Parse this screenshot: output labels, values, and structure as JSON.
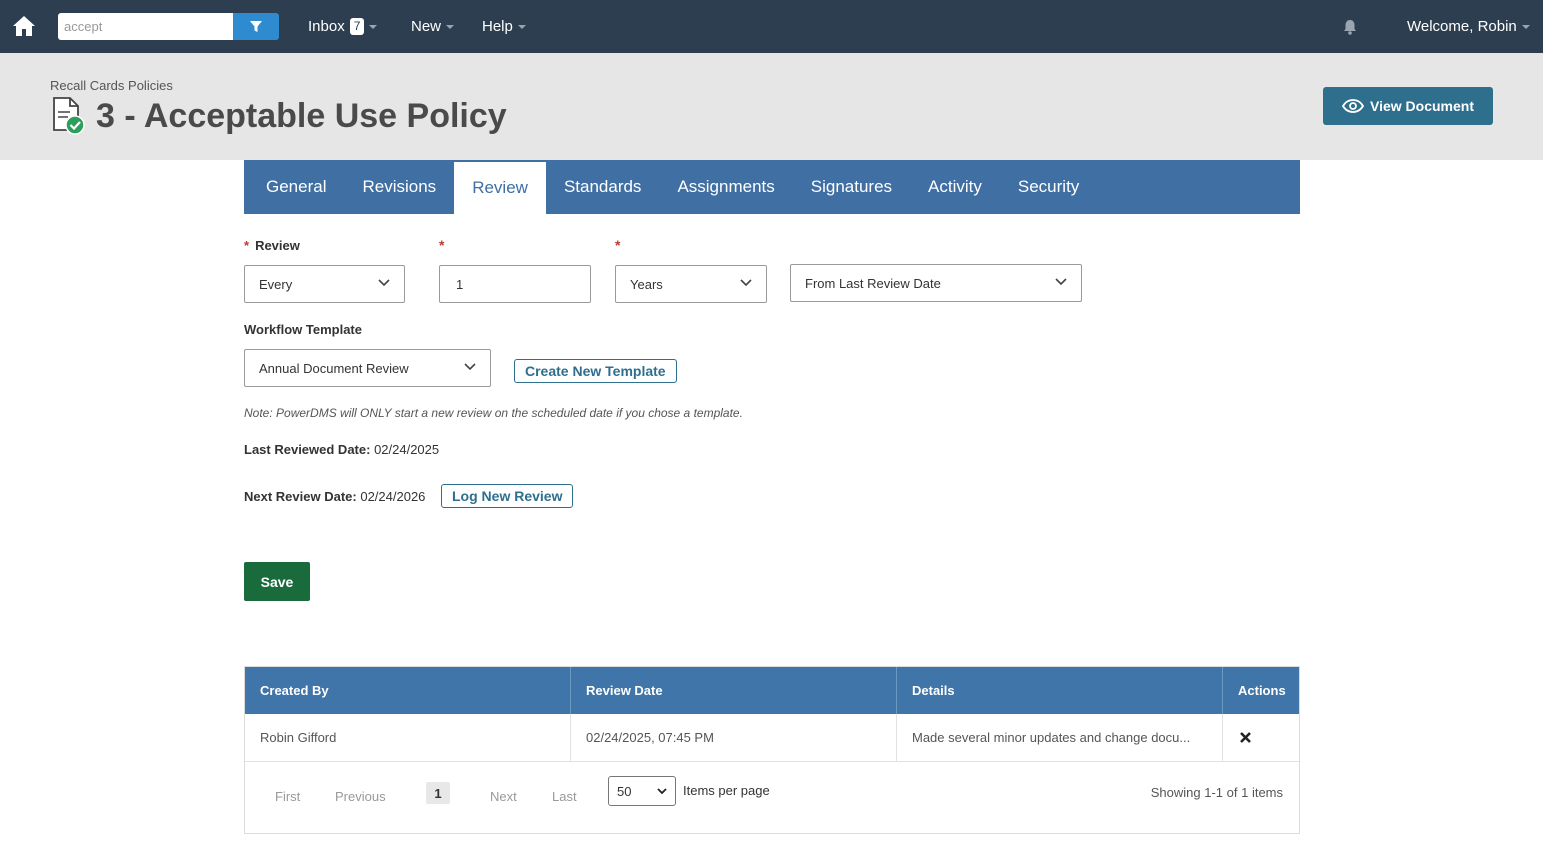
{
  "topnav": {
    "search": {
      "value": "accept"
    },
    "inbox_label": "Inbox",
    "inbox_count": "7",
    "new_label": "New",
    "help_label": "Help",
    "welcome_label": "Welcome, Robin"
  },
  "header": {
    "breadcrumb": "Recall Cards Policies",
    "title": "3 - Acceptable Use Policy",
    "view_document_label": "View Document"
  },
  "tabs": [
    {
      "label": "General"
    },
    {
      "label": "Revisions"
    },
    {
      "label": "Review"
    },
    {
      "label": "Standards"
    },
    {
      "label": "Assignments"
    },
    {
      "label": "Signatures"
    },
    {
      "label": "Activity"
    },
    {
      "label": "Security"
    }
  ],
  "active_tab": "Review",
  "form": {
    "review_label": "Review",
    "required_mark": "*",
    "frequency_type": "Every",
    "interval_value": "1",
    "interval_unit": "Years",
    "basis": "From Last Review Date",
    "workflow_template_label": "Workflow Template",
    "workflow_template": "Annual Document Review",
    "create_template_label": "Create New Template",
    "note": "Note: PowerDMS will ONLY start a new review on the scheduled date if you chose a template.",
    "last_reviewed_label": "Last Reviewed Date:",
    "last_reviewed_value": "02/24/2025",
    "next_review_label": "Next Review Date:",
    "next_review_value": "02/24/2026",
    "log_review_label": "Log New Review",
    "save_label": "Save"
  },
  "table": {
    "columns": [
      "Created By",
      "Review Date",
      "Details",
      "Actions"
    ],
    "rows": [
      {
        "created_by": "Robin Gifford",
        "review_date": "02/24/2025, 07:45 PM",
        "details": "Made several minor updates and change docu..."
      }
    ]
  },
  "pager": {
    "first": "First",
    "previous": "Previous",
    "current": "1",
    "next": "Next",
    "last": "Last",
    "page_size": "50",
    "items_per_page": "Items per page",
    "showing": "Showing 1-1 of 1 items"
  },
  "colors": {
    "nav_bg": "#2c3e50",
    "tab_bg": "#3f6fa3",
    "accent": "#2e6f8e",
    "save_green": "#1a6b3c",
    "required_red": "#c0392b"
  }
}
